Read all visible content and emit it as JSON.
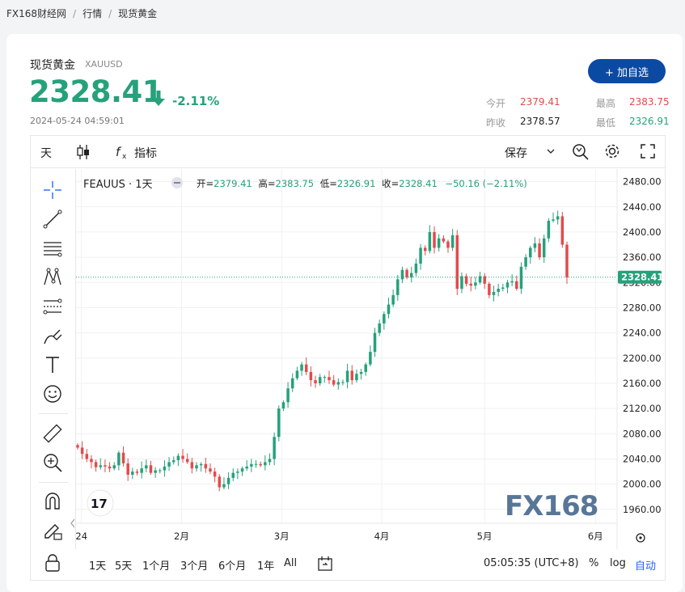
{
  "breadcrumb": [
    "FX168财经网",
    "行情",
    "现货黄金"
  ],
  "instrument": {
    "name": "现货黄金",
    "code": "XAUUSD",
    "price": "2328.41",
    "change_pct": "-2.11%",
    "timestamp": "2024-05-24 04:59:01",
    "watch_label": "+ 加自选"
  },
  "stats": {
    "open_label": "今开",
    "open": "2379.41",
    "high_label": "最高",
    "high": "2383.75",
    "prev_label": "昨收",
    "prev": "2378.57",
    "low_label": "最低",
    "low": "2326.91"
  },
  "toolbar": {
    "interval": "天",
    "indicators": "指标",
    "save": "保存"
  },
  "legend": {
    "symbol": "FEAUUS · 1天",
    "o_label": "开=",
    "o": "2379.41",
    "h_label": "高=",
    "h": "2383.75",
    "l_label": "低=",
    "l": "2326.91",
    "c_label": "收=",
    "c": "2328.41",
    "chg": "−50.16 (−2.11%)"
  },
  "bottom": {
    "ranges": [
      "1天",
      "5天",
      "1个月",
      "3个月",
      "6个月",
      "1年",
      "All"
    ],
    "clock": "05:05:35 (UTC+8)",
    "pct": "%",
    "log": "log",
    "auto": "自动"
  },
  "watermark": "FX168",
  "colors": {
    "up": "#26a17b",
    "down": "#e24b4b",
    "accent": "#0b4aa2"
  },
  "chart_data": {
    "type": "candlestick",
    "x_ticks": [
      "24",
      "2月",
      "3月",
      "4月",
      "5月",
      "6月"
    ],
    "y_ticks": [
      "2480.00",
      "2440.00",
      "2400.00",
      "2360.00",
      "2320.00",
      "2280.00",
      "2240.00",
      "2200.00",
      "2160.00",
      "2120.00",
      "2080.00",
      "2040.00",
      "2000.00",
      "1960.00"
    ],
    "ylim": [
      1938,
      2500
    ],
    "last_price": "2328.41",
    "closes": [
      2058,
      2048,
      2040,
      2035,
      2027,
      2030,
      2028,
      2025,
      2030,
      2050,
      2033,
      2015,
      2020,
      2018,
      2025,
      2030,
      2018,
      2022,
      2022,
      2028,
      2035,
      2038,
      2045,
      2040,
      2035,
      2025,
      2030,
      2032,
      2025,
      2020,
      2012,
      1995,
      2000,
      2010,
      2018,
      2020,
      2025,
      2028,
      2032,
      2032,
      2030,
      2035,
      2040,
      2075,
      2120,
      2130,
      2152,
      2168,
      2180,
      2190,
      2178,
      2165,
      2160,
      2170,
      2170,
      2165,
      2158,
      2162,
      2162,
      2180,
      2165,
      2175,
      2178,
      2190,
      2210,
      2240,
      2255,
      2270,
      2285,
      2300,
      2325,
      2340,
      2328,
      2335,
      2350,
      2375,
      2370,
      2400,
      2375,
      2390,
      2385,
      2375,
      2395,
      2310,
      2330,
      2318,
      2315,
      2320,
      2330,
      2318,
      2300,
      2305,
      2310,
      2312,
      2320,
      2322,
      2310,
      2345,
      2360,
      2375,
      2382,
      2360,
      2390,
      2418,
      2420,
      2425,
      2380,
      2328
    ]
  }
}
